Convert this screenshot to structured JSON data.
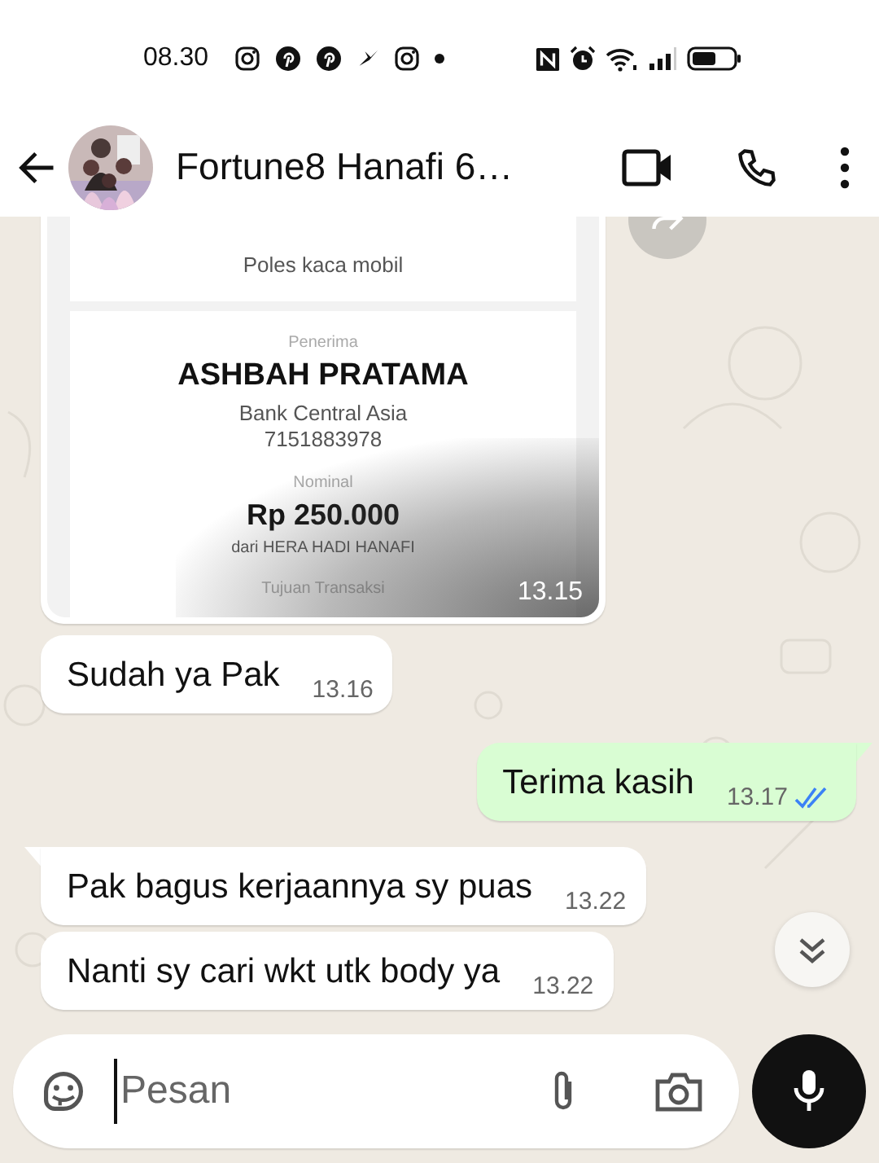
{
  "status_bar": {
    "time": "08.30"
  },
  "header": {
    "title": "Fortune8 Hanafi 6…"
  },
  "messages": [
    {
      "outgoing": false,
      "time": "13.15",
      "receipt": {
        "note": "Poles kaca mobil",
        "recipient_label": "Penerima",
        "recipient": "ASHBAH PRATAMA",
        "bank": "Bank Central Asia",
        "account": "7151883978",
        "amount_label": "Nominal",
        "amount": "Rp 250.000",
        "sender": "dari HERA HADI HANAFI",
        "purpose_label": "Tujuan Transaksi"
      }
    },
    {
      "kind": "text",
      "outgoing": false,
      "text": "Sudah ya Pak",
      "time": "13.16",
      "tail": false
    },
    {
      "kind": "text",
      "outgoing": true,
      "text": "Terima kasih",
      "time": "13.17",
      "tail": true,
      "read": true
    },
    {
      "kind": "text",
      "outgoing": false,
      "text": "Pak bagus kerjaannya sy puas",
      "time": "13.22",
      "tail": true
    },
    {
      "kind": "text",
      "outgoing": false,
      "text": "Nanti sy cari wkt utk body ya",
      "time": "13.22",
      "tail": false
    }
  ],
  "composer": {
    "placeholder": "Pesan"
  }
}
